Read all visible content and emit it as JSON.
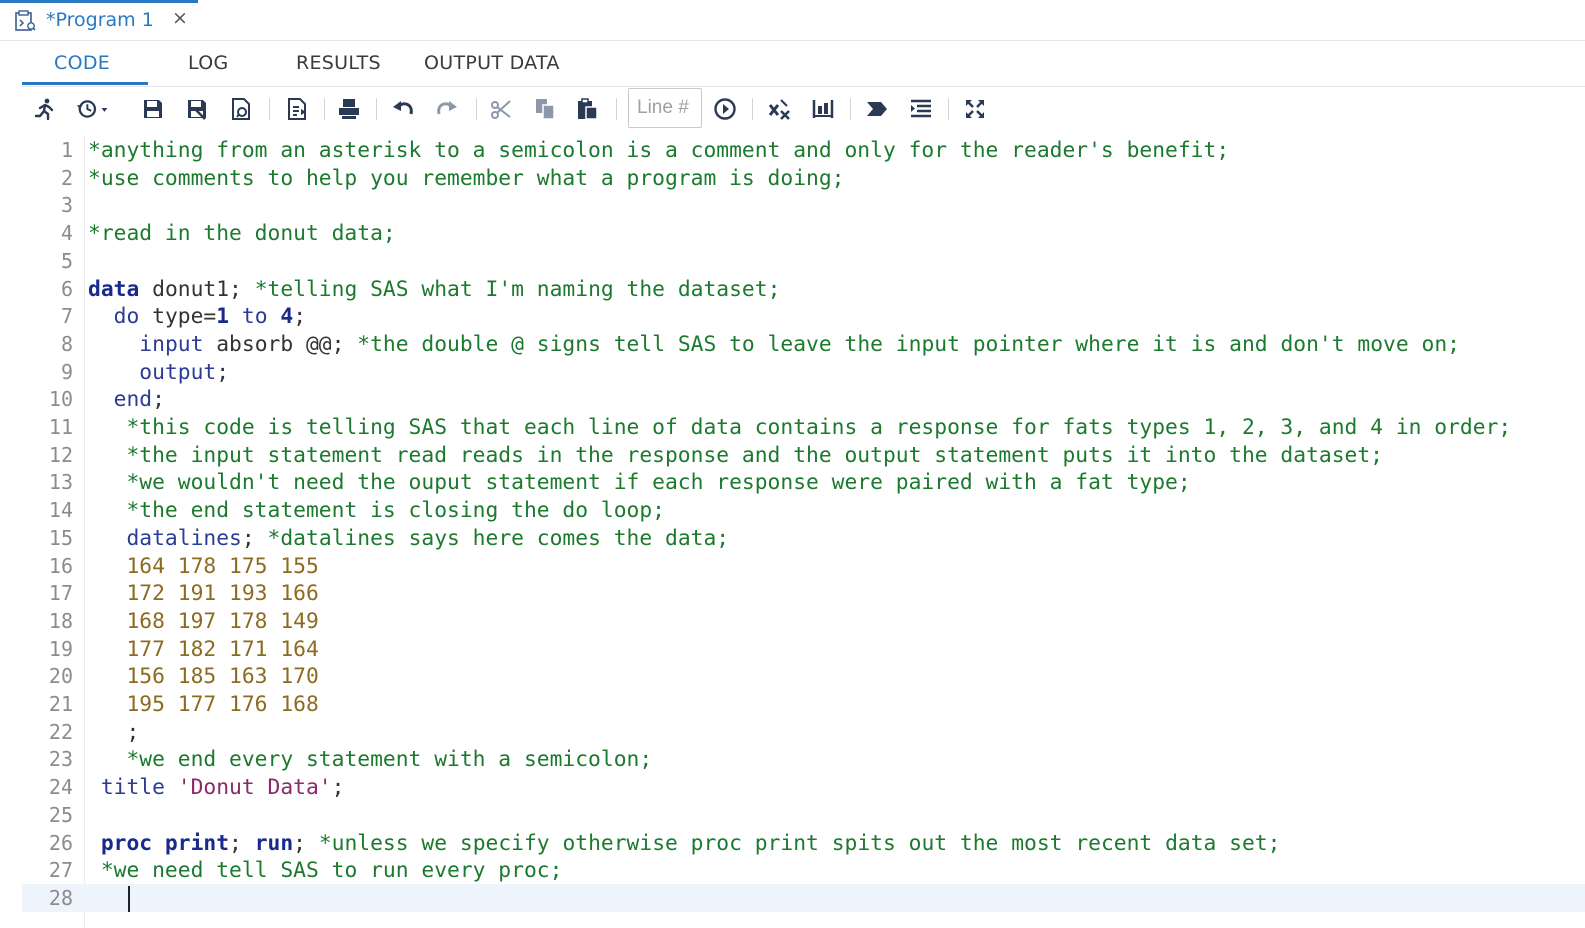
{
  "doc_tab": {
    "title": "*Program 1",
    "close": "×",
    "icon": "program-file-icon"
  },
  "subtabs": [
    {
      "label": "CODE",
      "active": true
    },
    {
      "label": "LOG",
      "active": false
    },
    {
      "label": "RESULTS",
      "active": false
    },
    {
      "label": "OUTPUT DATA",
      "active": false
    }
  ],
  "toolbar": {
    "line_placeholder": "Line #",
    "icons": [
      "run-icon",
      "history-icon",
      "save-icon",
      "save-as-icon",
      "save-file-icon",
      "export-icon",
      "print-icon",
      "undo-icon",
      "redo-icon",
      "cut-icon",
      "copy-icon",
      "paste-icon",
      "go-to-line-icon",
      "clear-code-icon",
      "snippets-icon",
      "submit-icon",
      "format-code-icon",
      "maximize-icon"
    ]
  },
  "editor": {
    "current_line": 28,
    "lines": [
      {
        "n": "1",
        "segs": [
          [
            "cm",
            "*anything from an asterisk to a semicolon is a comment and only for the reader's benefit;"
          ]
        ]
      },
      {
        "n": "2",
        "segs": [
          [
            "cm",
            "*use comments to help you remember what a program is doing;"
          ]
        ]
      },
      {
        "n": "3",
        "segs": []
      },
      {
        "n": "4",
        "segs": [
          [
            "cm",
            "*read in the donut data;"
          ]
        ]
      },
      {
        "n": "5",
        "segs": []
      },
      {
        "n": "6",
        "segs": [
          [
            "kw",
            "data"
          ],
          [
            "plain",
            " donut1; "
          ],
          [
            "cm",
            "*telling SAS what I'm naming the dataset;"
          ]
        ]
      },
      {
        "n": "7",
        "segs": [
          [
            "plain",
            "  "
          ],
          [
            "kn",
            "do"
          ],
          [
            "plain",
            " type="
          ],
          [
            "num",
            "1"
          ],
          [
            "plain",
            " "
          ],
          [
            "kn",
            "to"
          ],
          [
            "plain",
            " "
          ],
          [
            "num",
            "4"
          ],
          [
            "plain",
            ";"
          ]
        ]
      },
      {
        "n": "8",
        "segs": [
          [
            "plain",
            "    "
          ],
          [
            "kn",
            "input"
          ],
          [
            "plain",
            " absorb @@; "
          ],
          [
            "cm",
            "*the double @ signs tell SAS to leave the input pointer where it is and don't move on;"
          ]
        ]
      },
      {
        "n": "9",
        "segs": [
          [
            "plain",
            "    "
          ],
          [
            "kn",
            "output"
          ],
          [
            "plain",
            ";"
          ]
        ]
      },
      {
        "n": "10",
        "segs": [
          [
            "plain",
            "  "
          ],
          [
            "kn",
            "end"
          ],
          [
            "plain",
            ";"
          ]
        ]
      },
      {
        "n": "11",
        "segs": [
          [
            "plain",
            "   "
          ],
          [
            "cm",
            "*this code is telling SAS that each line of data contains a response for fats types 1, 2, 3, and 4 in order;"
          ]
        ]
      },
      {
        "n": "12",
        "segs": [
          [
            "plain",
            "   "
          ],
          [
            "cm",
            "*the input statement read reads in the response and the output statement puts it into the dataset;"
          ]
        ]
      },
      {
        "n": "13",
        "segs": [
          [
            "plain",
            "   "
          ],
          [
            "cm",
            "*we wouldn't need the ouput statement if each response were paired with a fat type;"
          ]
        ]
      },
      {
        "n": "14",
        "segs": [
          [
            "plain",
            "   "
          ],
          [
            "cm",
            "*the end statement is closing the do loop;"
          ]
        ]
      },
      {
        "n": "15",
        "segs": [
          [
            "plain",
            "   "
          ],
          [
            "kn",
            "datalines"
          ],
          [
            "plain",
            "; "
          ],
          [
            "cm",
            "*datalines says here comes the data;"
          ]
        ]
      },
      {
        "n": "16",
        "segs": [
          [
            "plain",
            "   "
          ],
          [
            "dl",
            "164 178 175 155"
          ]
        ]
      },
      {
        "n": "17",
        "segs": [
          [
            "plain",
            "   "
          ],
          [
            "dl",
            "172 191 193 166"
          ]
        ]
      },
      {
        "n": "18",
        "segs": [
          [
            "plain",
            "   "
          ],
          [
            "dl",
            "168 197 178 149"
          ]
        ]
      },
      {
        "n": "19",
        "segs": [
          [
            "plain",
            "   "
          ],
          [
            "dl",
            "177 182 171 164"
          ]
        ]
      },
      {
        "n": "20",
        "segs": [
          [
            "plain",
            "   "
          ],
          [
            "dl",
            "156 185 163 170"
          ]
        ]
      },
      {
        "n": "21",
        "segs": [
          [
            "plain",
            "   "
          ],
          [
            "dl",
            "195 177 176 168"
          ]
        ]
      },
      {
        "n": "22",
        "segs": [
          [
            "plain",
            "   ;"
          ]
        ]
      },
      {
        "n": "23",
        "segs": [
          [
            "plain",
            "   "
          ],
          [
            "cm",
            "*we end every statement with a semicolon;"
          ]
        ]
      },
      {
        "n": "24",
        "segs": [
          [
            "plain",
            " "
          ],
          [
            "kn",
            "title"
          ],
          [
            "plain",
            " "
          ],
          [
            "str",
            "'Donut Data'"
          ],
          [
            "plain",
            ";"
          ]
        ]
      },
      {
        "n": "25",
        "segs": []
      },
      {
        "n": "26",
        "segs": [
          [
            "plain",
            " "
          ],
          [
            "kw",
            "proc print"
          ],
          [
            "plain",
            "; "
          ],
          [
            "kw",
            "run"
          ],
          [
            "plain",
            "; "
          ],
          [
            "cm",
            "*unless we specify otherwise proc print spits out the most recent data set;"
          ]
        ]
      },
      {
        "n": "27",
        "segs": [
          [
            "plain",
            " "
          ],
          [
            "cm",
            "*we need tell SAS to run every proc;"
          ]
        ]
      },
      {
        "n": "28",
        "segs": []
      }
    ]
  },
  "colors": {
    "accent": "#2b78c2",
    "comment": "#1c7a2e",
    "keyword": "#1a2a8a",
    "datalines": "#8c6b20",
    "string": "#8a2a6a"
  }
}
